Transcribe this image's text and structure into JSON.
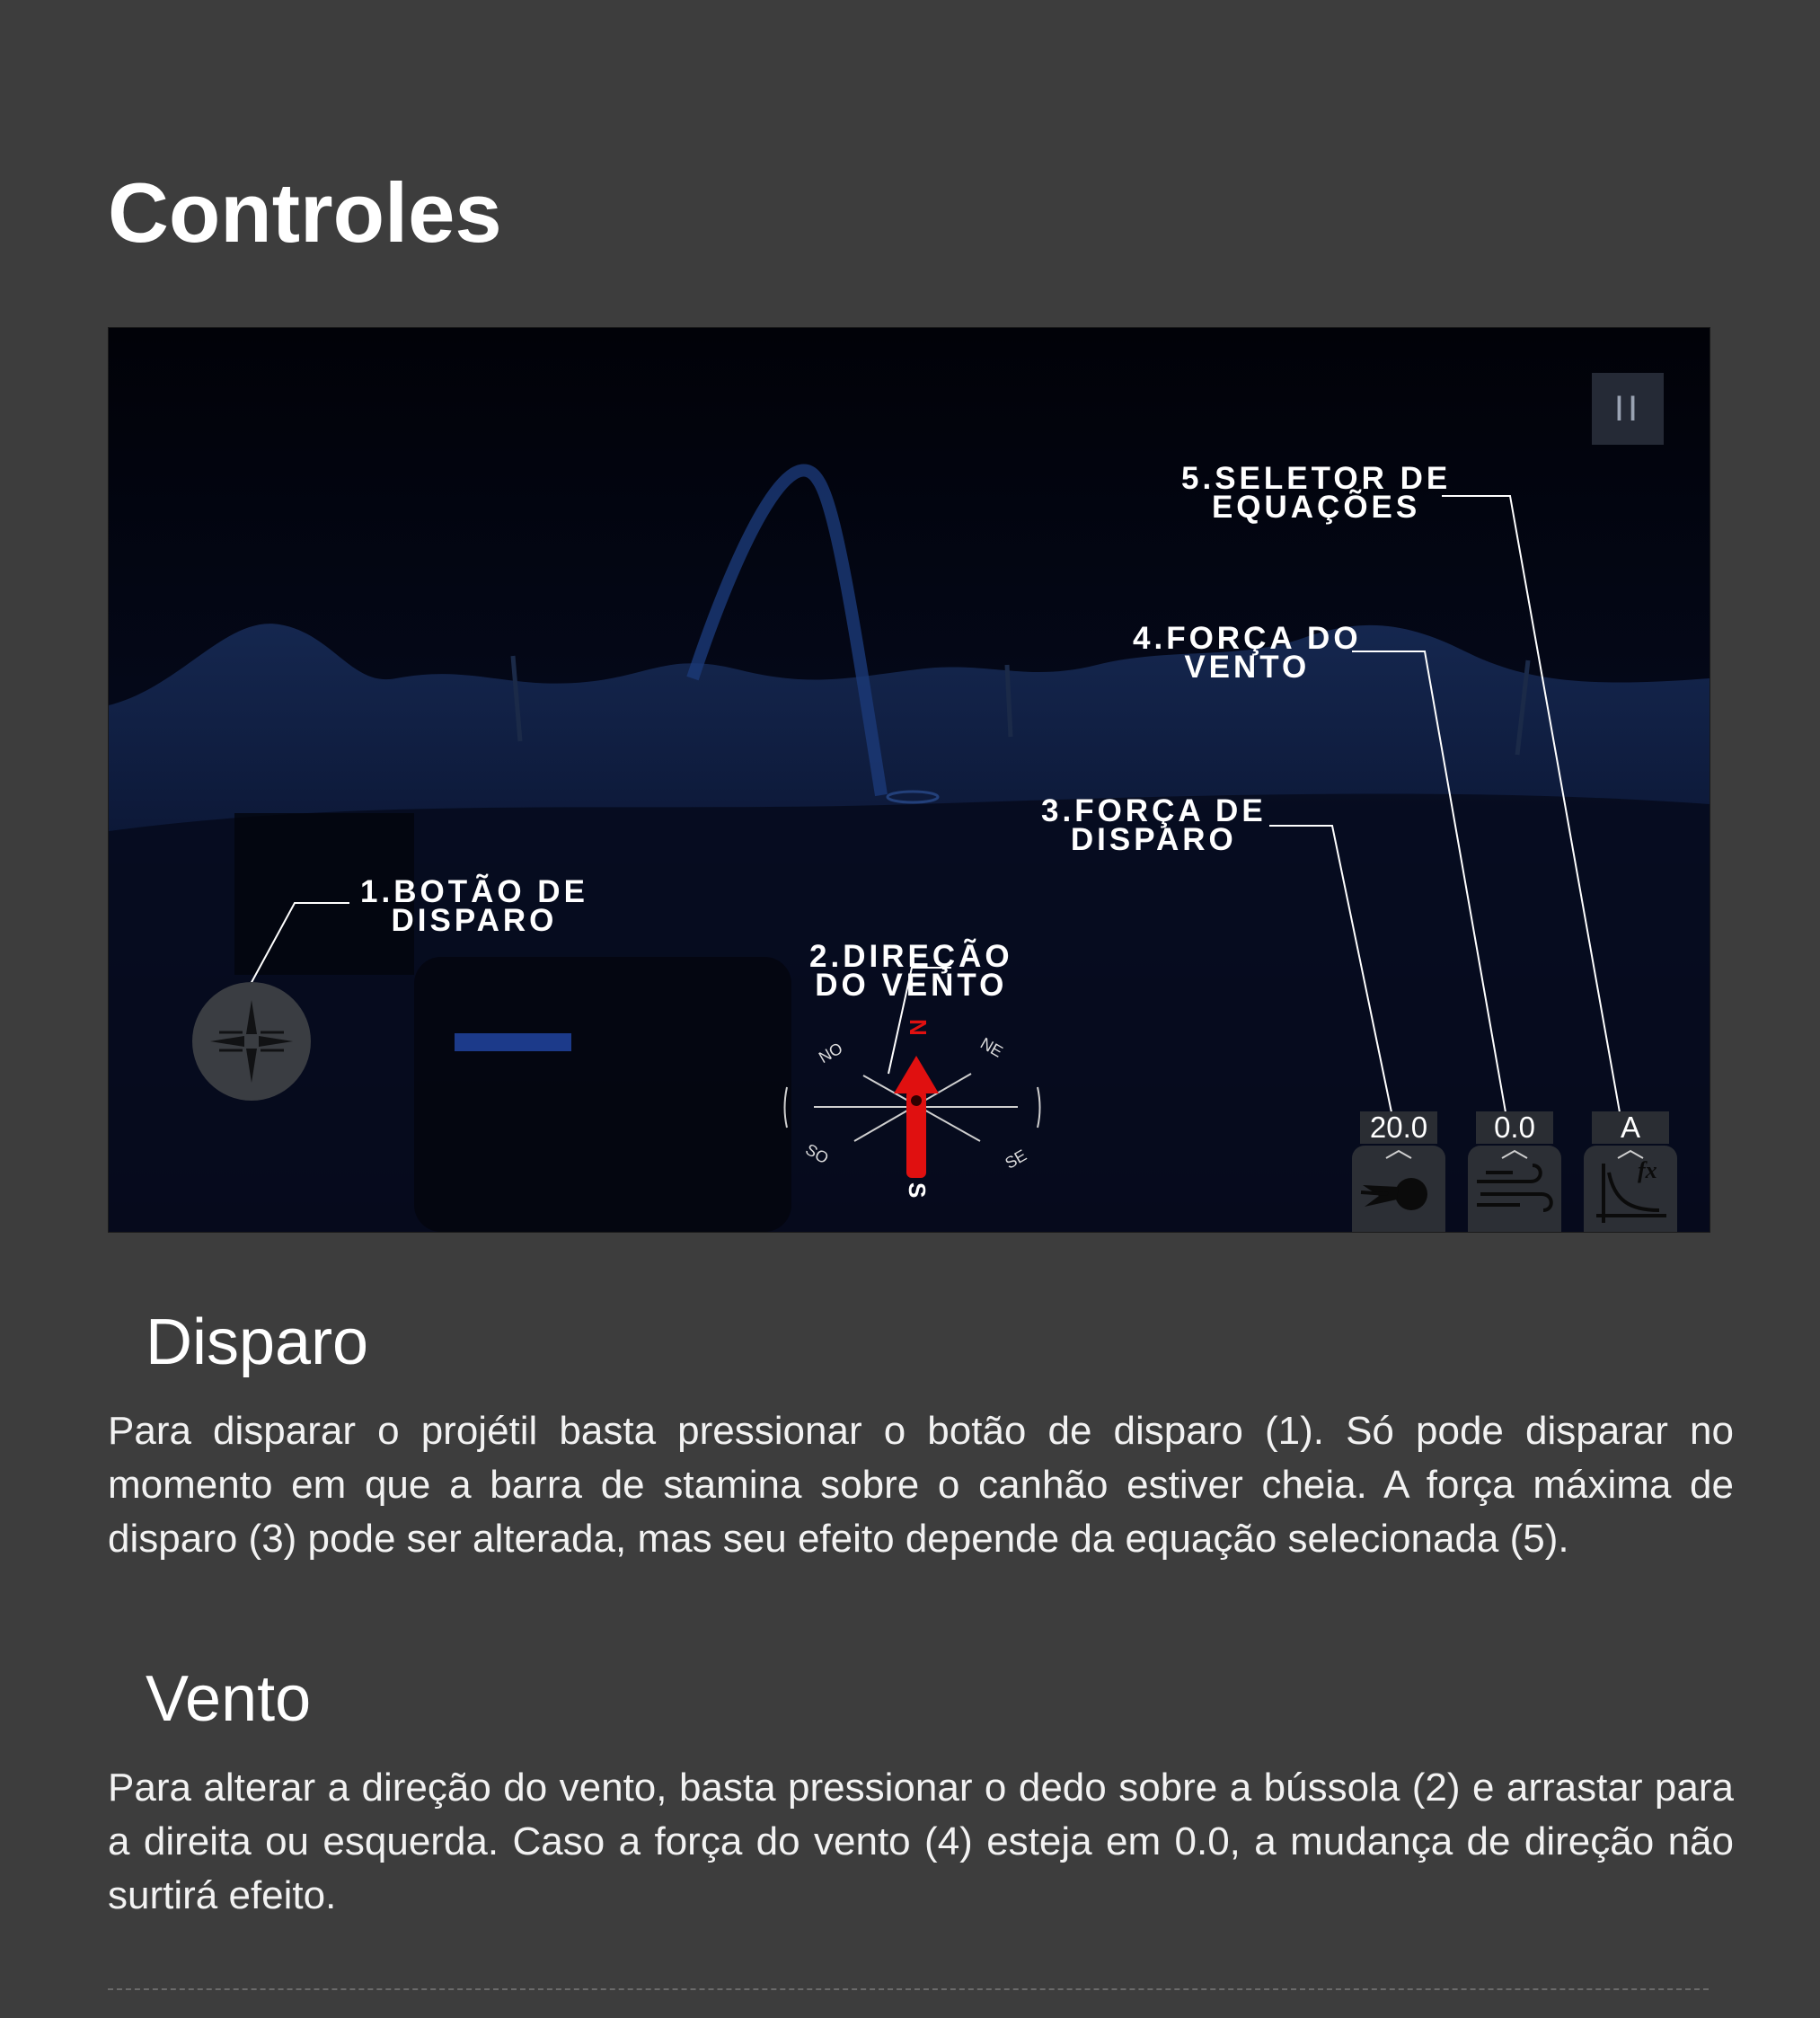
{
  "page": {
    "title": "Controles"
  },
  "game": {
    "pause_label": "II",
    "callouts": {
      "firing_button": {
        "number": "1",
        "line1": ".BOTÃO DE",
        "line2": "DISPARO"
      },
      "wind_direction": {
        "number": "2",
        "line1": ".DIREÇÃO",
        "line2": "DO VENTO"
      },
      "firing_force": {
        "number": "3",
        "line1": ".FORÇA DE",
        "line2": "DISPARO"
      },
      "wind_force": {
        "number": "4",
        "line1": ".FORÇA DO",
        "line2": "VENTO"
      },
      "equation_selector": {
        "number": "5",
        "line1": ".SELETOR DE",
        "line2": "EQUAÇÕES"
      }
    },
    "compass": {
      "north": "N",
      "south": "S",
      "northeast": "NE",
      "northwest": "NO",
      "southeast": "SE",
      "southwest": "SO"
    },
    "hud": {
      "firing_force_value": "20.0",
      "wind_force_value": "0.0",
      "equation_value": "A",
      "icons": [
        "comet-icon",
        "wind-icon",
        "function-graph-icon"
      ]
    },
    "colors": {
      "accent_red": "#e01010",
      "night_sky": "#02030a",
      "terrain": "#0a1330"
    }
  },
  "sections": {
    "disparo": {
      "heading": "Disparo",
      "text": "Para disparar o projétil basta pressionar o botão de disparo (1). Só pode disparar no momento em que a barra de stamina sobre o canhão estiver cheia. A força máxima de disparo (3) pode ser alterada, mas seu efeito depende da equação selecionada (5)."
    },
    "vento": {
      "heading": "Vento",
      "text": "Para alterar a direção do vento, basta pressionar o dedo sobre a bússola (2) e arrastar para a direita ou esquerda. Caso a força do vento (4) esteja em 0.0, a mudança de direção não surtirá efeito."
    }
  }
}
